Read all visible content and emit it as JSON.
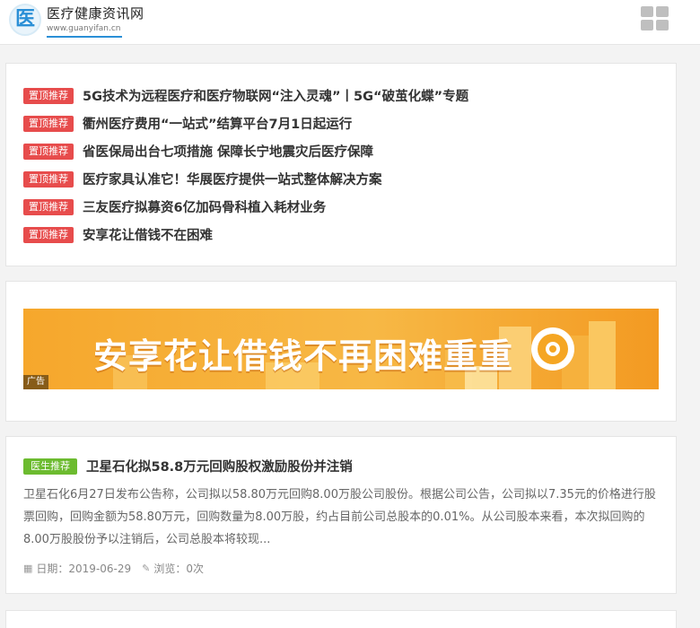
{
  "header": {
    "logo_glyph": "医",
    "logo_title": "医疗健康资讯网",
    "logo_url": "www.guanyifan.cn",
    "menu_icon": "grid-menu-icon"
  },
  "pinned": {
    "tag": "置顶推荐",
    "items": [
      {
        "title": "5G技术为远程医疗和医疗物联网“注入灵魂”丨5G“破茧化蝶”专题"
      },
      {
        "title": "衢州医疗费用“一站式”结算平台7月1日起运行"
      },
      {
        "title": "省医保局出台七项措施 保障长宁地震灾后医疗保障"
      },
      {
        "title": "医疗家具认准它！华展医疗提供一站式整体解决方案"
      },
      {
        "title": "三友医疗拟募资6亿加码骨科植入耗材业务"
      },
      {
        "title": "安享花让借钱不在困难"
      }
    ]
  },
  "ad": {
    "banner_text": "安享花让借钱不再困难重重",
    "badge": "广告"
  },
  "article": {
    "tag": "医生推荐",
    "title": "卫星石化拟58.8万元回购股权激励股份并注销",
    "summary": "卫星石化6月27日发布公告称，公司拟以58.80万元回购8.00万股公司股份。根据公司公告，公司拟以7.35元的价格进行股票回购，回购金额为58.80万元，回购数量为8.00万股，约占目前公司总股本的0.01%。从公司股本来看，本次拟回购的8.00万股股份予以注销后，公司总股本将较现...",
    "date_label": "日期：2019-06-29",
    "views_label": "浏览：0次"
  },
  "colors": {
    "pin_tag": "#e74c4c",
    "doctor_tag": "#6cbb2f",
    "banner": "#f6a72c"
  }
}
